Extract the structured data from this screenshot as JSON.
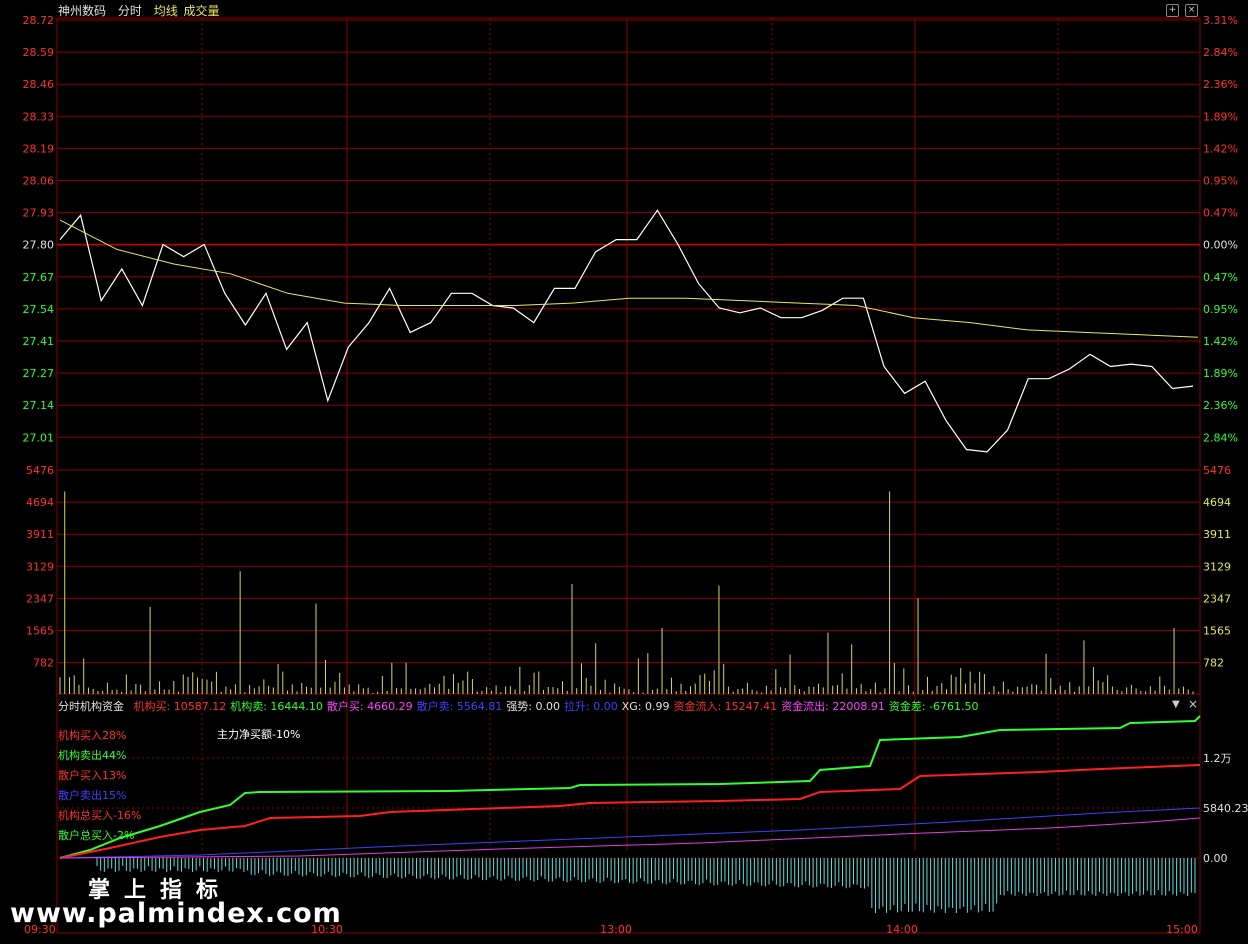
{
  "header": {
    "stock_name": "神州数码",
    "mode": "分时",
    "avg_label": "均线",
    "volume_label": "成交量"
  },
  "colors": {
    "price_line": "#ffffff",
    "avg_line": "#e8e85a",
    "grid": "#8b0000",
    "axis_red": "#ff3030",
    "axis_green": "#30ff30",
    "volume": "#d8d860"
  },
  "price_axis": {
    "left": [
      "28.72",
      "28.59",
      "28.46",
      "28.33",
      "28.19",
      "28.06",
      "27.93",
      "27.80",
      "27.67",
      "27.54",
      "27.41",
      "27.27",
      "27.14",
      "27.01"
    ],
    "right": [
      "3.31%",
      "2.84%",
      "2.36%",
      "1.89%",
      "1.42%",
      "0.95%",
      "0.47%",
      "0.00%",
      "0.47%",
      "0.95%",
      "1.42%",
      "1.89%",
      "2.36%",
      "2.84%"
    ],
    "prev_close": 27.8
  },
  "volume_axis": {
    "labels": [
      "5476",
      "4694",
      "3911",
      "3129",
      "2347",
      "1565",
      "782"
    ],
    "max": 5476
  },
  "time_axis": [
    "09:30",
    "10:30",
    "13:00",
    "14:00",
    "15:00"
  ],
  "indicator": {
    "title": "分时机构资金",
    "items": [
      {
        "label": "机构买: ",
        "value": "10587.12",
        "color": "#ff3030"
      },
      {
        "label": "机构卖: ",
        "value": "16444.10",
        "color": "#30ff30"
      },
      {
        "label": "散户买: ",
        "value": "4660.29",
        "color": "#ff40ff"
      },
      {
        "label": "散户卖: ",
        "value": "5564.81",
        "color": "#4040ff"
      },
      {
        "label": "强势: ",
        "value": "0.00",
        "color": "#e0e0e0"
      },
      {
        "label": "拉升: ",
        "value": "0.00",
        "color": "#4040ff"
      },
      {
        "label": "XG: ",
        "value": "0.99",
        "color": "#e0e0e0"
      },
      {
        "label": "资金流入: ",
        "value": "15247.41",
        "color": "#ff3030"
      },
      {
        "label": "资金流出: ",
        "value": "22008.91",
        "color": "#ff40ff"
      },
      {
        "label": "资金差: ",
        "value": "-6761.50",
        "color": "#30ff30"
      }
    ],
    "legend": [
      {
        "text": "机构买入28%",
        "color": "#ff3030"
      },
      {
        "text": "机构卖出44%",
        "color": "#30ff30"
      },
      {
        "text": "散户买入13%",
        "color": "#ff3030"
      },
      {
        "text": "散户卖出15%",
        "color": "#4040ff"
      },
      {
        "text": "机构总买入-16%",
        "color": "#ff3030"
      },
      {
        "text": "散户总买入-2%",
        "color": "#30ff30"
      }
    ],
    "net_label": "主力净买额-10%",
    "right_labels": [
      "1.2万",
      "5840.23",
      "0.00"
    ]
  },
  "watermark": {
    "cn": "掌上指标",
    "url": "www.palmindex.com"
  },
  "chart_data": {
    "type": "line",
    "title": "神州数码 分时",
    "x_times": [
      "09:30",
      "10:30",
      "13:00",
      "14:00",
      "15:00"
    ],
    "price": [
      27.82,
      27.92,
      27.57,
      27.7,
      27.55,
      27.8,
      27.75,
      27.8,
      27.6,
      27.47,
      27.6,
      27.37,
      27.48,
      27.16,
      27.38,
      27.48,
      27.62,
      27.44,
      27.48,
      27.6,
      27.6,
      27.55,
      27.54,
      27.48,
      27.62,
      27.62,
      27.77,
      27.82,
      27.82,
      27.94,
      27.8,
      27.64,
      27.54,
      27.52,
      27.54,
      27.5,
      27.5,
      27.53,
      27.58,
      27.58,
      27.3,
      27.19,
      27.24,
      27.08,
      26.96,
      26.95,
      27.04,
      27.25,
      27.25,
      27.29,
      27.35,
      27.3,
      27.31,
      27.3,
      27.21,
      27.22
    ],
    "avg": [
      27.9,
      27.78,
      27.72,
      27.68,
      27.6,
      27.56,
      27.55,
      27.55,
      27.55,
      27.56,
      27.58,
      27.58,
      27.57,
      27.56,
      27.55,
      27.5,
      27.48,
      27.45,
      27.44,
      27.43,
      27.42
    ],
    "volume": [
      5476,
      1300,
      1900,
      1500,
      900,
      2900,
      1100,
      700,
      400,
      600,
      800,
      500,
      300,
      450,
      1800,
      400,
      2300,
      600,
      500,
      4900,
      1200,
      900,
      500,
      600,
      800,
      700,
      1000
    ],
    "ylim": [
      27.01,
      28.72
    ]
  }
}
